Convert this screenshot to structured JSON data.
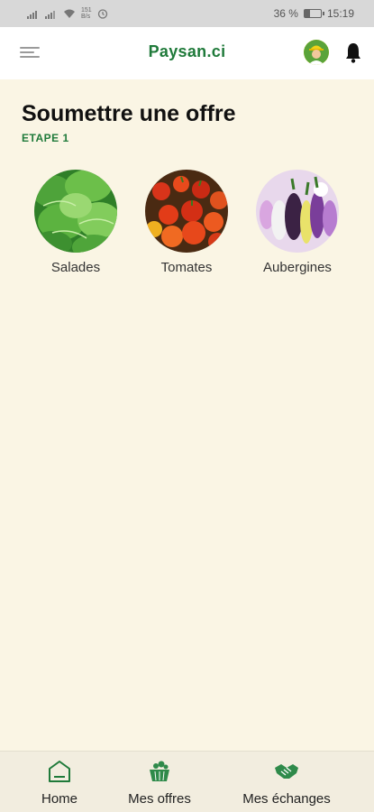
{
  "statusbar": {
    "speed_top": "151",
    "speed_bottom": "B/s",
    "battery_text": "36 %",
    "battery_level": 0.36,
    "time": "15:19"
  },
  "appbar": {
    "title": "Paysan.ci"
  },
  "page": {
    "title": "Soumettre une offre",
    "step": "ETAPE 1"
  },
  "products": [
    {
      "label": "Salades",
      "icon": "lettuce-image"
    },
    {
      "label": "Tomates",
      "icon": "tomatoes-image"
    },
    {
      "label": "Aubergines",
      "icon": "eggplants-image"
    }
  ],
  "bottom_nav": [
    {
      "label": "Home",
      "icon": "home-icon"
    },
    {
      "label": "Mes offres",
      "icon": "basket-icon"
    },
    {
      "label": "Mes échanges",
      "icon": "handshake-icon"
    }
  ],
  "colors": {
    "brand_green": "#1f7a3a",
    "background": "#faf5e4",
    "nav_background": "#f2eddf"
  }
}
